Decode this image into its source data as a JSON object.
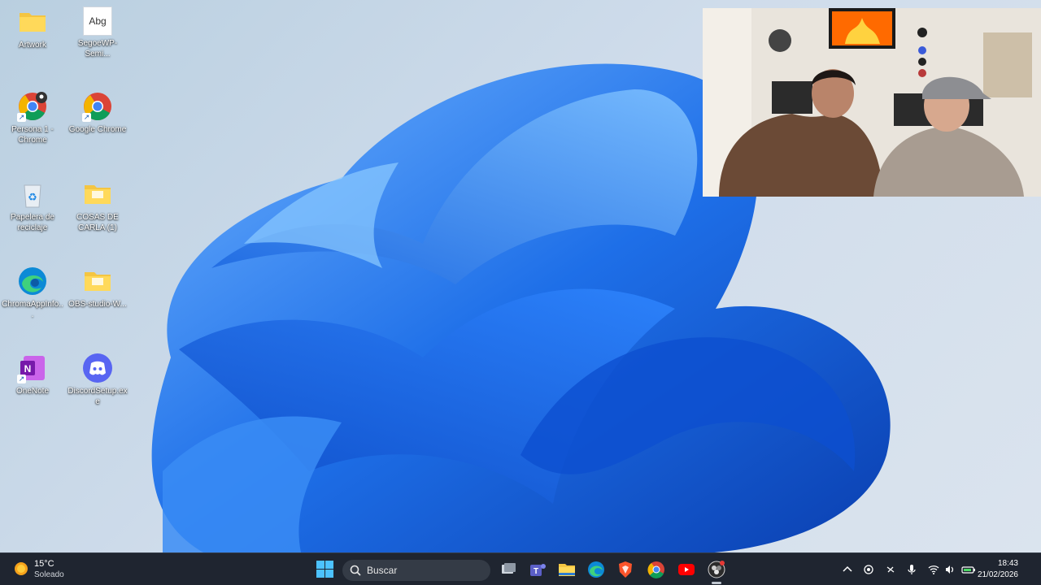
{
  "desktop": {
    "icons": [
      {
        "label": "Artwork",
        "icon": "folder-icon"
      },
      {
        "label": "SegoeWP-Semi...",
        "icon": "font-file-icon",
        "preview": "Abg"
      },
      {
        "label": "Persona 1 - Chrome",
        "icon": "chrome-profile-icon"
      },
      {
        "label": "Google Chrome",
        "icon": "chrome-icon"
      },
      {
        "label": "Papelera de reciclaje",
        "icon": "recycle-bin-icon"
      },
      {
        "label": "COSAS DE CARLA (1)",
        "icon": "folder-icon"
      },
      {
        "label": "ChromaAppInfo...",
        "icon": "edge-icon"
      },
      {
        "label": "OBS-studio-W...",
        "icon": "folder-icon"
      },
      {
        "label": "OneNote",
        "icon": "onenote-icon"
      },
      {
        "label": "DiscordSetup.exe",
        "icon": "discord-icon"
      }
    ]
  },
  "webcam": {
    "icon": "webcam-overlay"
  },
  "taskbar": {
    "weather": {
      "temp": "15°C",
      "desc": "Soleado",
      "icon": "sun-icon"
    },
    "start_icon": "windows-start-icon",
    "search": {
      "placeholder": "Buscar",
      "icon": "search-icon"
    },
    "apps": [
      "task-view-icon",
      "teams-icon",
      "file-explorer-icon",
      "edge-icon",
      "brave-icon",
      "chrome-icon",
      "youtube-icon",
      "obs-icon"
    ],
    "tray": [
      "chevron-up-icon",
      "location-icon",
      "mic-off-icon",
      "microphone-icon",
      "wifi-icon",
      "volume-icon",
      "battery-icon"
    ],
    "clock": {
      "time": "18:43",
      "date": "21/02/2026"
    }
  },
  "colors": {
    "taskbar": "#1f2530",
    "accent": "#1e6fe8",
    "wallpaper": "#cfdceb"
  }
}
